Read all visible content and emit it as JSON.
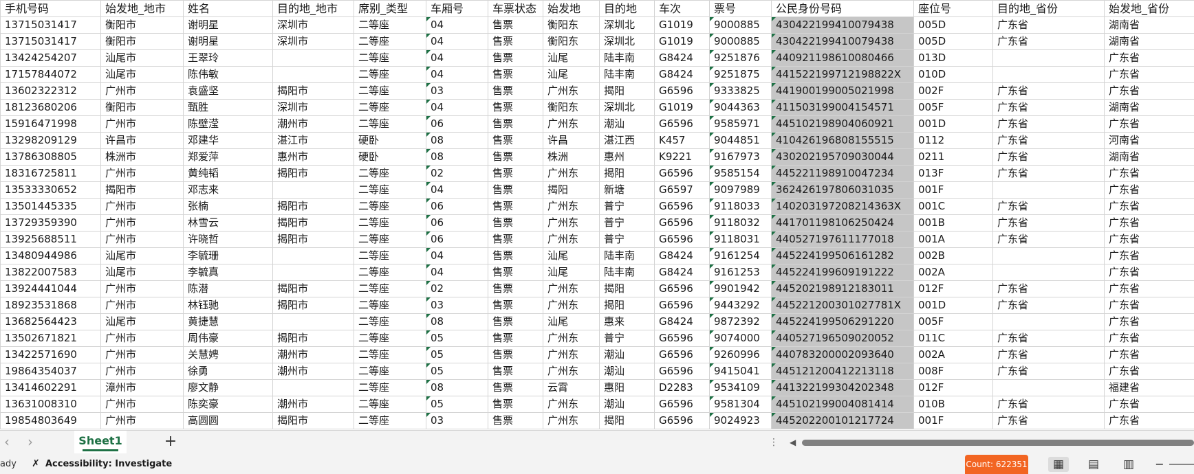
{
  "sheet": {
    "header": [
      "手机号码",
      "始发地_地市",
      "姓名",
      "目的地_地市",
      "席别_类型",
      "车厢号",
      "车票状态",
      "始发地",
      "目的地",
      "车次",
      "票号",
      "公民身份号码",
      "座位号",
      "目的地_省份",
      "始发地_省份"
    ],
    "rows": [
      [
        "13715031417",
        "衡阳市",
        "谢明星",
        "深圳市",
        "二等座",
        "04",
        "售票",
        "衡阳东",
        "深圳北",
        "G1019",
        "9000885",
        "430422199410079438",
        "005D",
        "广东省",
        "湖南省"
      ],
      [
        "13715031417",
        "衡阳市",
        "谢明星",
        "深圳市",
        "二等座",
        "04",
        "售票",
        "衡阳东",
        "深圳北",
        "G1019",
        "9000885",
        "430422199410079438",
        "005D",
        "广东省",
        "湖南省"
      ],
      [
        "13424254207",
        "汕尾市",
        "王翠玲",
        "",
        "二等座",
        "04",
        "售票",
        "汕尾",
        "陆丰南",
        "G8424",
        "9251876",
        "440921198610080466",
        "013D",
        "",
        "广东省"
      ],
      [
        "17157844072",
        "汕尾市",
        "陈伟敏",
        "",
        "二等座",
        "04",
        "售票",
        "汕尾",
        "陆丰南",
        "G8424",
        "9251875",
        "441522199712198822X",
        "010D",
        "",
        "广东省"
      ],
      [
        "13602322312",
        "广州市",
        "袁盛坚",
        "揭阳市",
        "二等座",
        "03",
        "售票",
        "广州东",
        "揭阳",
        "G6596",
        "9333825",
        "441900199005021998",
        "002F",
        "广东省",
        "广东省"
      ],
      [
        "18123680206",
        "衡阳市",
        "甄胜",
        "深圳市",
        "二等座",
        "04",
        "售票",
        "衡阳东",
        "深圳北",
        "G1019",
        "9044363",
        "411503199004154571",
        "005F",
        "广东省",
        "湖南省"
      ],
      [
        "15916471998",
        "广州市",
        "陈壁滢",
        "潮州市",
        "二等座",
        "06",
        "售票",
        "广州东",
        "潮汕",
        "G6596",
        "9585971",
        "445102198904060921",
        "001D",
        "广东省",
        "广东省"
      ],
      [
        "13298209129",
        "许昌市",
        "邓建华",
        "湛江市",
        "硬卧",
        "08",
        "售票",
        "许昌",
        "湛江西",
        "K457",
        "9044851",
        "410426196808155515",
        "0112",
        "广东省",
        "河南省"
      ],
      [
        "13786308805",
        "株洲市",
        "郑爱萍",
        "惠州市",
        "硬卧",
        "08",
        "售票",
        "株洲",
        "惠州",
        "K9221",
        "9167973",
        "430202195709030044",
        "0211",
        "广东省",
        "湖南省"
      ],
      [
        "18316725811",
        "广州市",
        "黄纯韬",
        "揭阳市",
        "二等座",
        "02",
        "售票",
        "广州东",
        "揭阳",
        "G6596",
        "9585154",
        "445221198910047234",
        "013F",
        "广东省",
        "广东省"
      ],
      [
        "13533330652",
        "揭阳市",
        "邓志来",
        "",
        "二等座",
        "04",
        "售票",
        "揭阳",
        "新塘",
        "G6597",
        "9097989",
        "362426197806031035",
        "001F",
        "",
        "广东省"
      ],
      [
        "13501445335",
        "广州市",
        "张楠",
        "揭阳市",
        "二等座",
        "06",
        "售票",
        "广州东",
        "普宁",
        "G6596",
        "9118033",
        "140203197208214363X",
        "001C",
        "广东省",
        "广东省"
      ],
      [
        "13729359390",
        "广州市",
        "林雪云",
        "揭阳市",
        "二等座",
        "06",
        "售票",
        "广州东",
        "普宁",
        "G6596",
        "9118032",
        "441701198106250424",
        "001B",
        "广东省",
        "广东省"
      ],
      [
        "13925688511",
        "广州市",
        "许晓哲",
        "揭阳市",
        "二等座",
        "06",
        "售票",
        "广州东",
        "普宁",
        "G6596",
        "9118031",
        "440527197611177018",
        "001A",
        "广东省",
        "广东省"
      ],
      [
        "13480944986",
        "汕尾市",
        "李毓珊",
        "",
        "二等座",
        "04",
        "售票",
        "汕尾",
        "陆丰南",
        "G8424",
        "9161254",
        "445224199506161282",
        "002B",
        "",
        "广东省"
      ],
      [
        "13822007583",
        "汕尾市",
        "李毓真",
        "",
        "二等座",
        "04",
        "售票",
        "汕尾",
        "陆丰南",
        "G8424",
        "9161253",
        "445224199609191222",
        "002A",
        "",
        "广东省"
      ],
      [
        "13924441044",
        "广州市",
        "陈潜",
        "揭阳市",
        "二等座",
        "02",
        "售票",
        "广州东",
        "揭阳",
        "G6596",
        "9901942",
        "445202198912183011",
        "012F",
        "广东省",
        "广东省"
      ],
      [
        "18923531868",
        "广州市",
        "林钰驰",
        "揭阳市",
        "二等座",
        "03",
        "售票",
        "广州东",
        "揭阳",
        "G6596",
        "9443292",
        "445221200301027781X",
        "001D",
        "广东省",
        "广东省"
      ],
      [
        "13682564423",
        "汕尾市",
        "黄捷慧",
        "",
        "二等座",
        "08",
        "售票",
        "汕尾",
        "惠来",
        "G8424",
        "9872392",
        "445224199506291220",
        "005F",
        "",
        "广东省"
      ],
      [
        "13502671821",
        "广州市",
        "周伟豪",
        "揭阳市",
        "二等座",
        "05",
        "售票",
        "广州东",
        "普宁",
        "G6596",
        "9074000",
        "440527196509020052",
        "011C",
        "广东省",
        "广东省"
      ],
      [
        "13422571690",
        "广州市",
        "关慧娉",
        "潮州市",
        "二等座",
        "05",
        "售票",
        "广州东",
        "潮汕",
        "G6596",
        "9260996",
        "440783200002093640",
        "002A",
        "广东省",
        "广东省"
      ],
      [
        "19864354037",
        "广州市",
        "徐勇",
        "潮州市",
        "二等座",
        "05",
        "售票",
        "广州东",
        "潮汕",
        "G6596",
        "9415041",
        "445121200412213118",
        "008F",
        "广东省",
        "广东省"
      ],
      [
        "13414602291",
        "漳州市",
        "廖文静",
        "",
        "二等座",
        "08",
        "售票",
        "云霄",
        "惠阳",
        "D2283",
        "9534109",
        "441322199304202348",
        "012F",
        "",
        "福建省"
      ],
      [
        "13631008310",
        "广州市",
        "陈奕豪",
        "潮州市",
        "二等座",
        "05",
        "售票",
        "广州东",
        "潮汕",
        "G6596",
        "9581304",
        "445102199004081414",
        "010B",
        "广东省",
        "广东省"
      ],
      [
        "19854803649",
        "广州市",
        "高圆圆",
        "揭阳市",
        "二等座",
        "03",
        "售票",
        "广州东",
        "揭阳",
        "G6596",
        "9024923",
        "445202200101217724",
        "001F",
        "广东省",
        "广东省"
      ]
    ]
  },
  "tabs": {
    "sheet_name": "Sheet1",
    "add_label": "+",
    "prev_label": "‹",
    "next_label": "›",
    "dots_label": "⋮",
    "scroll_left_label": "◀"
  },
  "status": {
    "ready": "ady",
    "accessibility": "Accessibility: Investigate",
    "count": "Count: 622351"
  },
  "icons": {
    "accessibility": "accessibility-icon",
    "normal_view": "grid-icon",
    "page_layout": "page-layout-icon",
    "page_break": "page-break-icon"
  },
  "colors": {
    "accent": "#1e7145",
    "count_badge": "#f26522",
    "selection": "#c6c6c6"
  }
}
